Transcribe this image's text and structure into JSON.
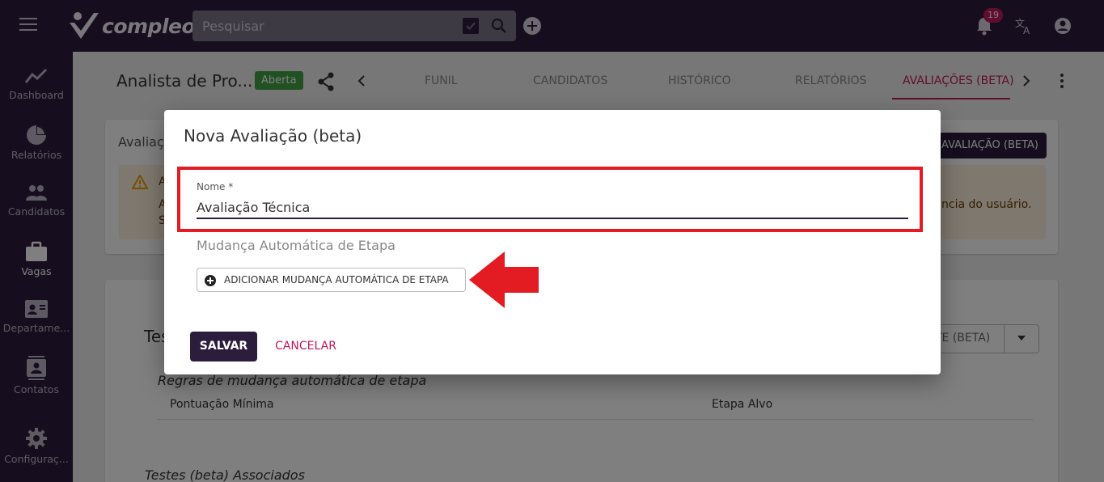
{
  "app": {
    "logo_text": "compleo"
  },
  "topbar": {
    "search_placeholder": "Pesquisar",
    "notification_count": "19"
  },
  "sidebar": {
    "items": [
      {
        "label": "Dashboard",
        "icon": "trend-icon"
      },
      {
        "label": "Relatórios",
        "icon": "pie-chart-icon"
      },
      {
        "label": "Candidatos",
        "icon": "people-icon"
      },
      {
        "label": "Vagas",
        "icon": "briefcase-icon"
      },
      {
        "label": "Departame...",
        "icon": "contact-card-icon"
      },
      {
        "label": "Contatos",
        "icon": "contacts-icon"
      },
      {
        "label": "Configuraç...",
        "icon": "gear-icon"
      }
    ],
    "active": "Vagas"
  },
  "header": {
    "title": "Analista de Pro...",
    "status": "Aberta",
    "tabs": [
      {
        "label": "FUNIL"
      },
      {
        "label": "CANDIDATOS"
      },
      {
        "label": "HISTÓRICO"
      },
      {
        "label": "RELATÓRIOS"
      },
      {
        "label": "AVALIAÇÕES (BETA)"
      }
    ],
    "active_tab": "AVALIAÇÕES (BETA)"
  },
  "background": {
    "card1_title": "Avaliaç",
    "card1_button": "AVALIAÇÃO (BETA)",
    "alert_line1": "A",
    "alert_line2": "A",
    "alert_line3": "S",
    "alert_tail": "ncia do usuário.",
    "card2_title": "Tes",
    "split_button": "TE (BETA)",
    "rules_title": "Regras de mudança automática de etapa",
    "col_min_score": "Pontuação Mínima",
    "col_target_stage": "Etapa Alvo",
    "tests_title": "Testes (beta) Associados"
  },
  "modal": {
    "title": "Nova Avaliação (beta)",
    "name_label": "Nome *",
    "name_value": "Avaliação Técnica",
    "auto_stage_label": "Mudança Automática de Etapa",
    "add_rule_button": "ADICIONAR MUDANÇA AUTOMÁTICA DE ETAPA",
    "save_button": "SALVAR",
    "cancel_button": "CANCELAR"
  },
  "colors": {
    "brand": "#2c1d3d",
    "accent": "#c2185b",
    "status_open": "#43a047",
    "annotation_red": "#e31b23"
  }
}
